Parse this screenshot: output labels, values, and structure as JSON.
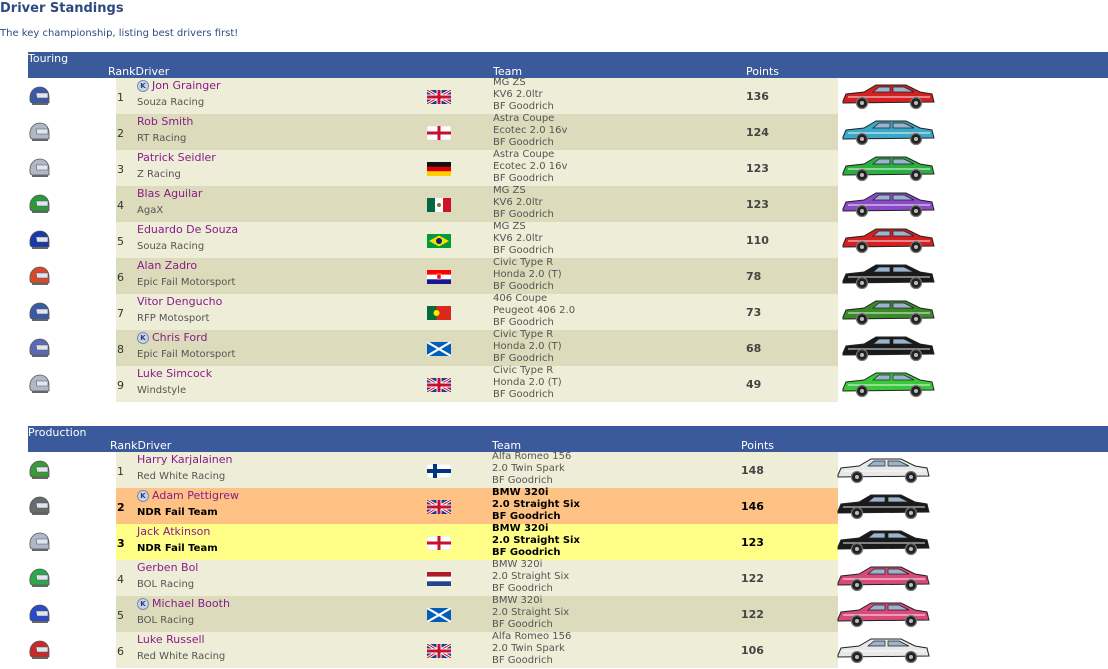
{
  "page": {
    "title": "Driver Standings",
    "subtitle": "The key championship, listing best drivers first!"
  },
  "sections": [
    {
      "name": "Touring",
      "headers": {
        "rank_driver": "RankDriver",
        "team": "Team",
        "points": "Points"
      },
      "rows": [
        {
          "rank": "1",
          "driver": "Jon Grainger",
          "k": true,
          "team": "Souza Racing",
          "flag": "uk",
          "car_lines": [
            "MG ZS",
            "KV6 2.0ltr",
            "BF Goodrich"
          ],
          "points": "136",
          "car_color": "#d42020",
          "helmet_color": "#3a5aa8",
          "bg": "light"
        },
        {
          "rank": "2",
          "driver": "Rob Smith",
          "k": false,
          "team": "RT Racing",
          "flag": "england",
          "car_lines": [
            "Astra Coupe",
            "Ecotec 2.0 16v",
            "BF Goodrich"
          ],
          "points": "124",
          "car_color": "#3aa8c8",
          "helmet_color": "#b0b8c8",
          "bg": "dark"
        },
        {
          "rank": "3",
          "driver": "Patrick Seidler",
          "k": false,
          "team": "Z Racing",
          "flag": "germany",
          "car_lines": [
            "Astra Coupe",
            "Ecotec 2.0 16v",
            "BF Goodrich"
          ],
          "points": "123",
          "car_color": "#2ab040",
          "helmet_color": "#b0b8c8",
          "bg": "light"
        },
        {
          "rank": "4",
          "driver": "Blas Aguilar",
          "k": false,
          "team": "AgaX",
          "flag": "mexico",
          "car_lines": [
            "MG ZS",
            "KV6 2.0ltr",
            "BF Goodrich"
          ],
          "points": "123",
          "car_color": "#8a4ac8",
          "helmet_color": "#2a9a3a",
          "bg": "dark"
        },
        {
          "rank": "5",
          "driver": "Eduardo De Souza",
          "k": false,
          "team": "Souza Racing",
          "flag": "brazil",
          "car_lines": [
            "MG ZS",
            "KV6 2.0ltr",
            "BF Goodrich"
          ],
          "points": "110",
          "car_color": "#d42020",
          "helmet_color": "#1a3aa8",
          "bg": "light"
        },
        {
          "rank": "6",
          "driver": "Alan Zadro",
          "k": false,
          "team": "Epic Fail Motorsport",
          "flag": "croatia",
          "car_lines": [
            "Civic Type R",
            "Honda 2.0 (T)",
            "BF Goodrich"
          ],
          "points": "78",
          "car_color": "#1a1a1a",
          "helmet_color": "#d84a2a",
          "bg": "dark"
        },
        {
          "rank": "7",
          "driver": "Vitor Dengucho",
          "k": false,
          "team": "RFP Motosport",
          "flag": "portugal",
          "car_lines": [
            "406 Coupe",
            "Peugeot 406 2.0",
            "BF Goodrich"
          ],
          "points": "73",
          "car_color": "#3a8a2a",
          "helmet_color": "#3a5aa8",
          "bg": "light"
        },
        {
          "rank": "8",
          "driver": "Chris Ford",
          "k": true,
          "team": "Epic Fail Motorsport",
          "flag": "scotland",
          "car_lines": [
            "Civic Type R",
            "Honda 2.0 (T)",
            "BF Goodrich"
          ],
          "points": "68",
          "car_color": "#1a1a1a",
          "helmet_color": "#5a6ab8",
          "bg": "dark"
        },
        {
          "rank": "9",
          "driver": "Luke Simcock",
          "k": false,
          "team": "Windstyle",
          "flag": "uk",
          "car_lines": [
            "Civic Type R",
            "Honda 2.0 (T)",
            "BF Goodrich"
          ],
          "points": "49",
          "car_color": "#3ac83a",
          "helmet_color": "#b0b8c8",
          "bg": "light"
        }
      ]
    },
    {
      "name": "Production",
      "headers": {
        "rank_driver": "RankDriver",
        "team": "Team",
        "points": "Points"
      },
      "rows": [
        {
          "rank": "1",
          "driver": "Harry Karjalainen",
          "k": false,
          "team": "Red White Racing",
          "flag": "finland",
          "car_lines": [
            "Alfa Romeo 156",
            "2.0 Twin Spark",
            "BF Goodrich"
          ],
          "points": "148",
          "car_color": "#e8e8e8",
          "helmet_color": "#3a9a3a",
          "bg": "light"
        },
        {
          "rank": "2",
          "driver": "Adam Pettigrew",
          "k": true,
          "team": "NDR Fail Team",
          "flag": "uk",
          "car_lines": [
            "BMW 320i",
            "2.0 Straight Six",
            "BF Goodrich"
          ],
          "points": "146",
          "car_color": "#1a1a1a",
          "helmet_color": "#6a6a6a",
          "bg": "orange",
          "bold": true
        },
        {
          "rank": "3",
          "driver": "Jack Atkinson",
          "k": false,
          "team": "NDR Fail Team",
          "flag": "england",
          "car_lines": [
            "BMW 320i",
            "2.0 Straight Six",
            "BF Goodrich"
          ],
          "points": "123",
          "car_color": "#1a1a1a",
          "helmet_color": "#b0b8c8",
          "bg": "yellow",
          "bold": true
        },
        {
          "rank": "4",
          "driver": "Gerben Bol",
          "k": false,
          "team": "BOL Racing",
          "flag": "netherlands",
          "car_lines": [
            "BMW 320i",
            "2.0 Straight Six",
            "BF Goodrich"
          ],
          "points": "122",
          "car_color": "#d84a7a",
          "helmet_color": "#2aa84a",
          "bg": "light"
        },
        {
          "rank": "5",
          "driver": "Michael Booth",
          "k": true,
          "team": "BOL Racing",
          "flag": "scotland",
          "car_lines": [
            "BMW 320i",
            "2.0 Straight Six",
            "BF Goodrich"
          ],
          "points": "122",
          "car_color": "#d84a7a",
          "helmet_color": "#2a4ac8",
          "bg": "dark"
        },
        {
          "rank": "6",
          "driver": "Luke Russell",
          "k": false,
          "team": "Red White Racing",
          "flag": "uk",
          "car_lines": [
            "Alfa Romeo 156",
            "2.0 Twin Spark",
            "BF Goodrich"
          ],
          "points": "106",
          "car_color": "#e8e8e8",
          "helmet_color": "#c82a2a",
          "bg": "light"
        }
      ]
    }
  ]
}
